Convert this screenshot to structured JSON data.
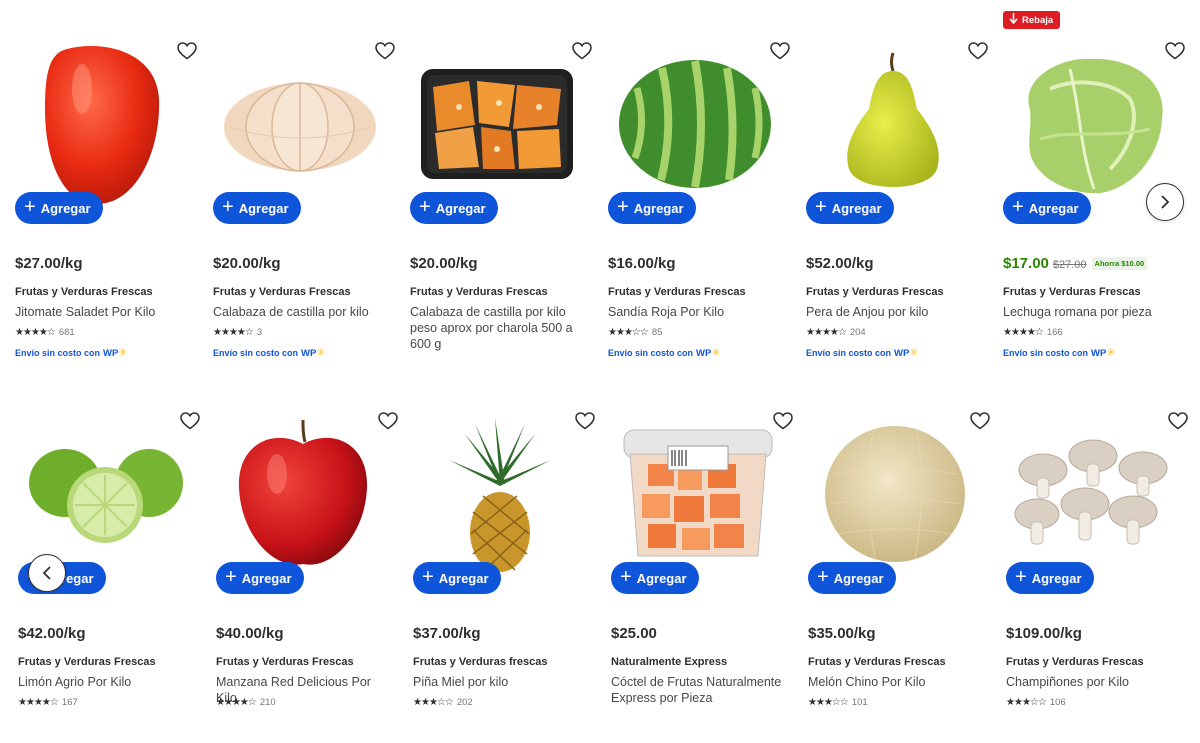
{
  "ui": {
    "add_label": "Agregar",
    "shipping_text": "Envío sin costo con",
    "shipping_brand": "W+",
    "rebaja_label": "Rebaja",
    "accent_color": "#0f55d9",
    "sale_color": "#2a8703"
  },
  "products": [
    {
      "price": "$27.00/kg",
      "brand": "Frutas y Verduras Frescas",
      "title": "Jitomate Saladet Por Kilo",
      "stars": "★★★★☆",
      "rating": 4,
      "reviews": "681",
      "shipping": true,
      "icon": "tomato"
    },
    {
      "price": "$20.00/kg",
      "brand": "Frutas y Verduras Frescas",
      "title": "Calabaza de castilla por kilo",
      "stars": "★★★★☆",
      "rating": 3.5,
      "reviews": "3",
      "shipping": true,
      "icon": "pumpkin"
    },
    {
      "price": "$20.00/kg",
      "brand": "Frutas y Verduras Frescas",
      "title": "Calabaza de castilla por kilo peso aprox por charola 500 a 600 g",
      "stars": "",
      "reviews": "",
      "shipping": false,
      "icon": "pumpkin-tray"
    },
    {
      "price": "$16.00/kg",
      "brand": "Frutas y Verduras Frescas",
      "title": "Sandía Roja Por Kilo",
      "stars": "★★★☆☆",
      "rating": 2.5,
      "reviews": "85",
      "shipping": true,
      "icon": "watermelon"
    },
    {
      "price": "$52.00/kg",
      "brand": "Frutas y Verduras Frescas",
      "title": "Pera de Anjou por kilo",
      "stars": "★★★★☆",
      "rating": 3.5,
      "reviews": "204",
      "shipping": true,
      "icon": "pear"
    },
    {
      "price": "$17.00",
      "price_was": "$27.00",
      "saving": "Ahorra $10.00",
      "brand": "Frutas y Verduras Frescas",
      "title": "Lechuga romana por pieza",
      "stars": "★★★★☆",
      "rating": 3.5,
      "reviews": "166",
      "shipping": true,
      "icon": "lettuce"
    }
  ],
  "products_row2": [
    {
      "price": "$42.00/kg",
      "brand": "Frutas y Verduras Frescas",
      "title": "Limón Agrio Por Kilo",
      "stars": "★★★★☆",
      "rating": 3.5,
      "reviews": "167",
      "icon": "lime"
    },
    {
      "price": "$40.00/kg",
      "brand": "Frutas y Verduras Frescas",
      "title": "Manzana Red Delicious Por Kilo",
      "stars": "★★★★☆",
      "rating": 4,
      "reviews": "210",
      "icon": "apple"
    },
    {
      "price": "$37.00/kg",
      "brand": "Frutas y Verduras frescas",
      "title": "Piña Miel por kilo",
      "stars": "★★★☆☆",
      "rating": 2.5,
      "reviews": "202",
      "icon": "pineapple"
    },
    {
      "price": "$25.00",
      "brand": "Naturalmente Express",
      "title": "Cóctel de Frutas Naturalmente Express por Pieza",
      "stars": "",
      "reviews": "",
      "icon": "fruit-cup"
    },
    {
      "price": "$35.00/kg",
      "brand": "Frutas y Verduras Frescas",
      "title": "Melón Chino Por Kilo",
      "stars": "★★★☆☆",
      "rating": 3,
      "reviews": "101",
      "icon": "melon"
    },
    {
      "price": "$109.00/kg",
      "brand": "Frutas y Verduras Frescas",
      "title": "Champiñones por Kilo",
      "stars": "★★★☆☆",
      "rating": 3,
      "reviews": "106",
      "icon": "mushrooms"
    }
  ]
}
